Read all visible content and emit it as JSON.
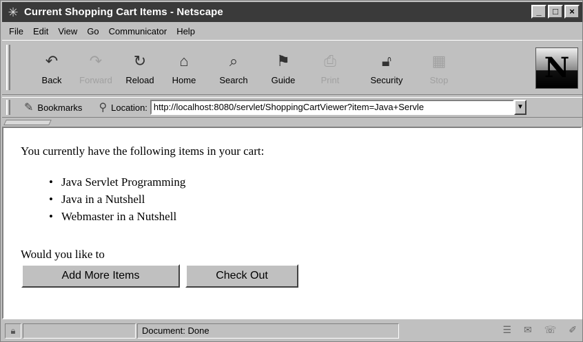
{
  "window": {
    "title": "Current Shopping Cart Items - Netscape",
    "controls": [
      "_",
      "□",
      "×"
    ]
  },
  "menubar": {
    "items": [
      {
        "label": "File"
      },
      {
        "label": "Edit"
      },
      {
        "label": "View"
      },
      {
        "label": "Go"
      },
      {
        "label": "Communicator"
      },
      {
        "label": "Help"
      }
    ]
  },
  "toolbar": {
    "buttons": [
      {
        "label": "Back",
        "icon": "back-arrow-icon",
        "enabled": true
      },
      {
        "label": "Forward",
        "icon": "forward-arrow-icon",
        "enabled": false
      },
      {
        "label": "Reload",
        "icon": "reload-icon",
        "enabled": true
      },
      {
        "label": "Home",
        "icon": "home-icon",
        "enabled": true
      },
      {
        "label": "Search",
        "icon": "search-icon",
        "enabled": true
      },
      {
        "label": "Guide",
        "icon": "guide-icon",
        "enabled": true
      },
      {
        "label": "Print",
        "icon": "print-icon",
        "enabled": false
      },
      {
        "label": "Security",
        "icon": "security-lock-icon",
        "enabled": true
      },
      {
        "label": "Stop",
        "icon": "stop-icon",
        "enabled": false
      }
    ],
    "logo_letter": "N"
  },
  "locationbar": {
    "bookmarks_label": "Bookmarks",
    "location_label": "Location:",
    "url": "http://localhost:8080/servlet/ShoppingCartViewer?item=Java+Servle"
  },
  "content": {
    "intro": "You currently have the following items in your cart:",
    "items": [
      "Java Servlet Programming",
      "Java in a Nutshell",
      "Webmaster in a Nutshell"
    ],
    "question": "Would you like to",
    "add_button": "Add More Items",
    "checkout_button": "Check Out"
  },
  "statusbar": {
    "status": "Document: Done"
  }
}
